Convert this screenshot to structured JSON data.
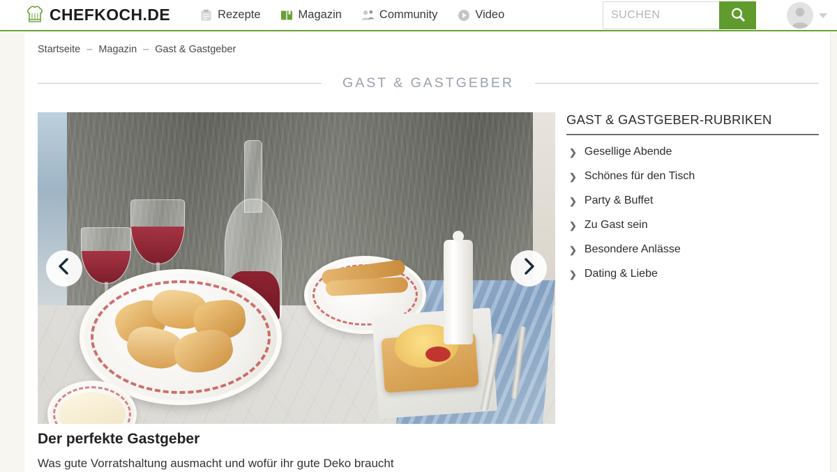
{
  "header": {
    "brand": "CHEFKOCH.DE",
    "logo_icon": "chef-hat-icon",
    "nav": [
      {
        "label": "Rezepte",
        "icon": "clipboard-icon"
      },
      {
        "label": "Magazin",
        "icon": "book-icon"
      },
      {
        "label": "Community",
        "icon": "people-icon"
      },
      {
        "label": "Video",
        "icon": "play-circle-icon"
      }
    ],
    "search": {
      "placeholder": "SUCHEN",
      "value": "",
      "button_icon": "search-icon"
    },
    "account": {
      "avatar_icon": "user-avatar-icon",
      "caret_icon": "chevron-down-icon"
    },
    "accent_color": "#5f9b2d",
    "underline_color": "#6aa036"
  },
  "breadcrumb": {
    "items": [
      "Startseite",
      "Magazin",
      "Gast & Gastgeber"
    ],
    "separator": "–"
  },
  "section": {
    "title": "GAST & GASTGEBER",
    "title_color": "#9aa0ab"
  },
  "hero": {
    "prev_icon": "chevron-left-icon",
    "next_icon": "chevron-right-icon",
    "alt": "Gedeckter Tisch mit Weingläsern, Karaffe und Gebäck",
    "title": "Der perfekte Gastgeber",
    "subtitle": "Was gute Vorratshaltung ausmacht und wofür ihr gute Deko braucht"
  },
  "sidebar": {
    "heading": "GAST & GASTGEBER-RUBRIKEN",
    "items": [
      {
        "label": "Gesellige Abende",
        "icon": "chevron-right-icon"
      },
      {
        "label": "Schönes für den Tisch",
        "icon": "chevron-right-icon"
      },
      {
        "label": "Party & Buffet",
        "icon": "chevron-right-icon"
      },
      {
        "label": "Zu Gast sein",
        "icon": "chevron-right-icon"
      },
      {
        "label": "Besondere Anlässe",
        "icon": "chevron-right-icon"
      },
      {
        "label": "Dating & Liebe",
        "icon": "chevron-right-icon"
      }
    ]
  }
}
